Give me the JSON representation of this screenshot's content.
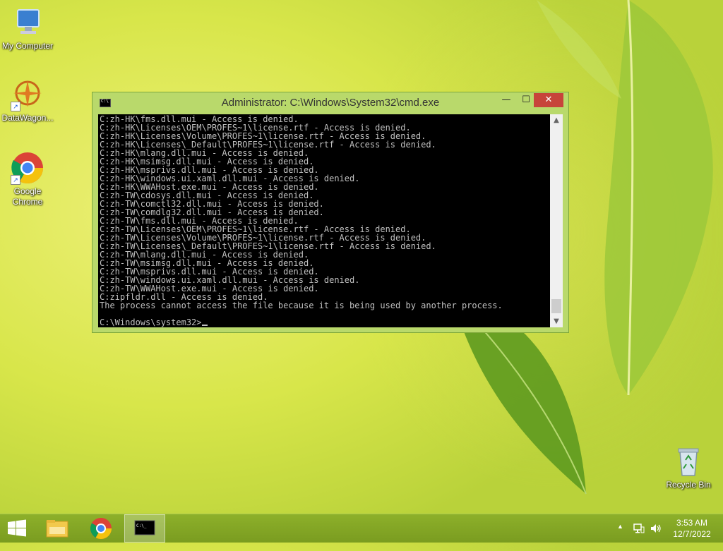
{
  "desktop": {
    "icons": [
      {
        "label": "My Computer"
      },
      {
        "label": "DataWagon..."
      },
      {
        "label": "Google Chrome"
      },
      {
        "label": "Recycle Bin"
      }
    ]
  },
  "window": {
    "title": "Administrator: C:\\Windows\\System32\\cmd.exe",
    "controls": {
      "minimize": "—",
      "maximize": "☐",
      "close": "✕"
    },
    "console_lines": [
      "C:zh-HK\\fms.dll.mui - Access is denied.",
      "C:zh-HK\\Licenses\\OEM\\PROFES~1\\license.rtf - Access is denied.",
      "C:zh-HK\\Licenses\\Volume\\PROFES~1\\license.rtf - Access is denied.",
      "C:zh-HK\\Licenses\\_Default\\PROFES~1\\license.rtf - Access is denied.",
      "C:zh-HK\\mlang.dll.mui - Access is denied.",
      "C:zh-HK\\msimsg.dll.mui - Access is denied.",
      "C:zh-HK\\msprivs.dll.mui - Access is denied.",
      "C:zh-HK\\windows.ui.xaml.dll.mui - Access is denied.",
      "C:zh-HK\\WWAHost.exe.mui - Access is denied.",
      "C:zh-TW\\cdosys.dll.mui - Access is denied.",
      "C:zh-TW\\comctl32.dll.mui - Access is denied.",
      "C:zh-TW\\comdlg32.dll.mui - Access is denied.",
      "C:zh-TW\\fms.dll.mui - Access is denied.",
      "C:zh-TW\\Licenses\\OEM\\PROFES~1\\license.rtf - Access is denied.",
      "C:zh-TW\\Licenses\\Volume\\PROFES~1\\license.rtf - Access is denied.",
      "C:zh-TW\\Licenses\\_Default\\PROFES~1\\license.rtf - Access is denied.",
      "C:zh-TW\\mlang.dll.mui - Access is denied.",
      "C:zh-TW\\msimsg.dll.mui - Access is denied.",
      "C:zh-TW\\msprivs.dll.mui - Access is denied.",
      "C:zh-TW\\windows.ui.xaml.dll.mui - Access is denied.",
      "C:zh-TW\\WWAHost.exe.mui - Access is denied.",
      "C:zipfldr.dll - Access is denied.",
      "The process cannot access the file because it is being used by another process."
    ],
    "prompt": "C:\\Windows\\system32>"
  },
  "taskbar": {
    "apps": [
      {
        "name": "file-explorer"
      },
      {
        "name": "google-chrome"
      },
      {
        "name": "command-prompt",
        "active": true
      }
    ],
    "tray": {
      "time": "3:53 AM",
      "date": "12/7/2022"
    }
  },
  "colors": {
    "window_frame": "#b9d96b",
    "close_button": "#c7443a",
    "taskbar": "#8db02a",
    "console_bg": "#000000",
    "console_text": "#c0c0c0"
  }
}
